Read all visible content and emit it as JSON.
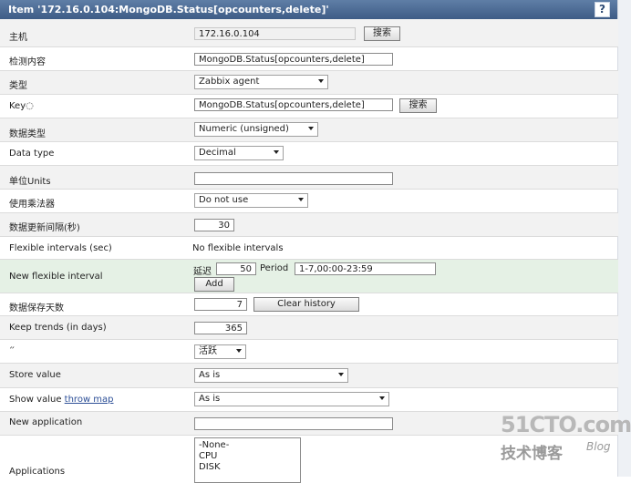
{
  "window": {
    "title": "Item '172.16.0.104:MongoDB.Status[opcounters,delete]'",
    "help": "?"
  },
  "rows": {
    "host": {
      "label": "主机",
      "value": "172.16.0.104",
      "button": "搜索"
    },
    "description": {
      "label": "检测内容",
      "value": "MongoDB.Status[opcounters,delete]"
    },
    "type": {
      "label": "类型",
      "value": "Zabbix agent"
    },
    "key": {
      "label": "Key◌",
      "value": "MongoDB.Status[opcounters,delete]",
      "button": "搜索"
    },
    "value_type": {
      "label": "数据类型",
      "value": "Numeric (unsigned)"
    },
    "data_type": {
      "label": "Data type",
      "value": "Decimal"
    },
    "units": {
      "label": "单位Units",
      "value": ""
    },
    "multiplier": {
      "label": "使用乘法器",
      "value": "Do not use"
    },
    "delay": {
      "label": "数据更新间隔(秒)",
      "value": "30"
    },
    "flexible_intervals": {
      "label": "Flexible intervals (sec)",
      "value": "No flexible intervals"
    },
    "new_flexible": {
      "label": "New flexible interval",
      "delay_label": "延迟",
      "delay_value": "50",
      "period_label": "Period",
      "period_value": "1-7,00:00-23:59",
      "add_button": "Add"
    },
    "history": {
      "label": "数据保存天数",
      "value": "7",
      "button": "Clear history"
    },
    "trends": {
      "label": "Keep trends (in days)",
      "value": "365"
    },
    "status": {
      "label": "״",
      "value": "活跃"
    },
    "store_value": {
      "label": "Store value",
      "value": "As is"
    },
    "show_value": {
      "label": "Show value",
      "link": "throw map",
      "value": "As is"
    },
    "new_application": {
      "label": "New application",
      "value": ""
    },
    "applications": {
      "label": "Applications",
      "options": [
        "-None-",
        "CPU",
        "DISK"
      ]
    }
  },
  "watermark": {
    "main": "51CTO.com",
    "sub": "技术博客",
    "blog": "Blog"
  }
}
